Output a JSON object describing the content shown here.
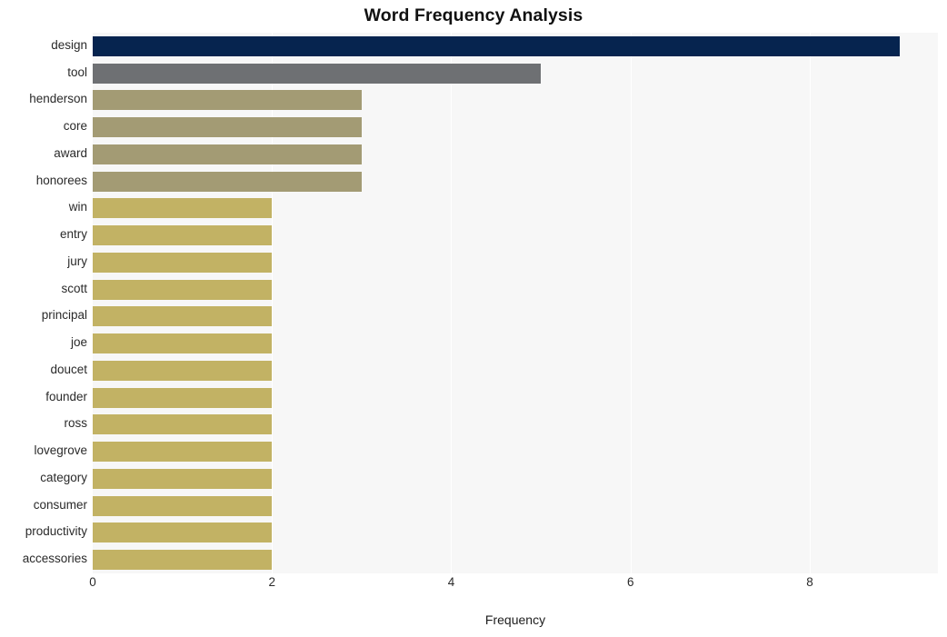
{
  "chart_data": {
    "type": "bar",
    "orientation": "horizontal",
    "title": "Word Frequency Analysis",
    "xlabel": "Frequency",
    "ylabel": "",
    "categories": [
      "design",
      "tool",
      "henderson",
      "core",
      "award",
      "honorees",
      "win",
      "entry",
      "jury",
      "scott",
      "principal",
      "joe",
      "doucet",
      "founder",
      "ross",
      "lovegrove",
      "category",
      "consumer",
      "productivity",
      "accessories"
    ],
    "values": [
      9,
      5,
      3,
      3,
      3,
      3,
      2,
      2,
      2,
      2,
      2,
      2,
      2,
      2,
      2,
      2,
      2,
      2,
      2,
      2
    ],
    "bar_colors": [
      "#06244f",
      "#6e7073",
      "#a39b74",
      "#a39b74",
      "#a39b74",
      "#a39b74",
      "#c2b264",
      "#c2b264",
      "#c2b264",
      "#c2b264",
      "#c2b264",
      "#c2b264",
      "#c2b264",
      "#c2b264",
      "#c2b264",
      "#c2b264",
      "#c2b264",
      "#c2b264",
      "#c2b264",
      "#c2b264"
    ],
    "xlim": [
      0,
      9.43
    ],
    "ylim_categories": 20,
    "xticks": [
      0,
      2,
      4,
      6,
      8
    ],
    "xtick_labels": [
      "0",
      "2",
      "4",
      "6",
      "8"
    ],
    "grid": true,
    "grid_axis": "x",
    "legend": false,
    "plot_background": "#f7f7f7",
    "figure_background": "#ffffff",
    "gridline_color": "#ffffff"
  }
}
